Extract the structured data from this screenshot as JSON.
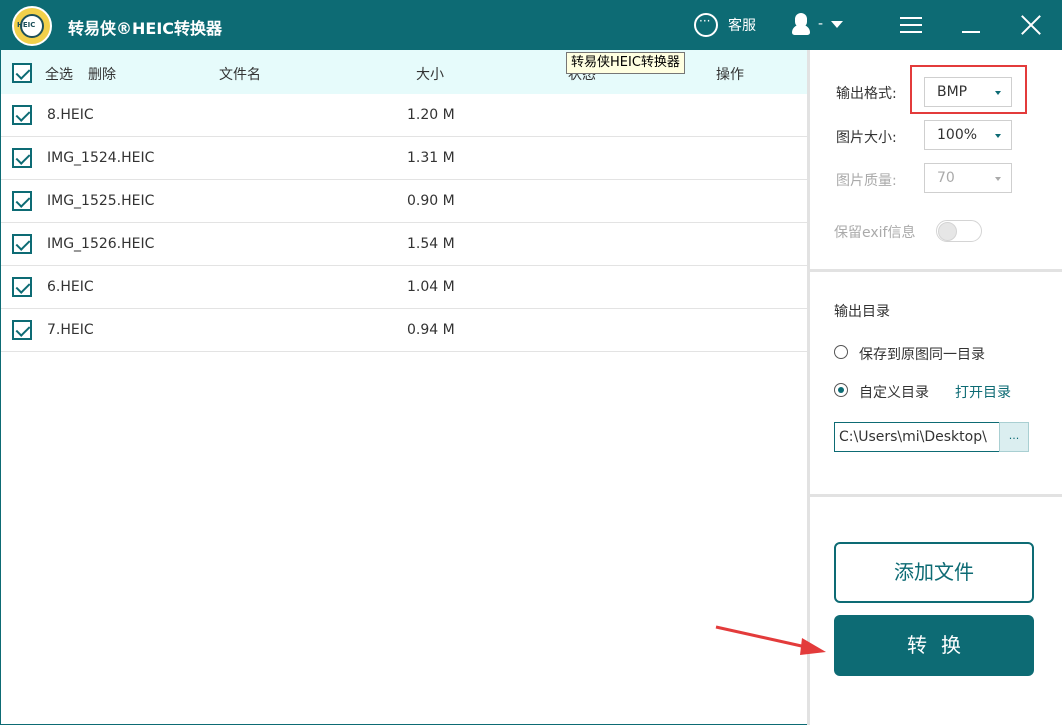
{
  "app": {
    "title": "转易侠®HEIC转换器",
    "logo_text": "HEIC",
    "service_label": "客服",
    "user_name": "-",
    "tooltip": "转易侠HEIC转换器"
  },
  "table": {
    "select_all": "全选",
    "delete": "删除",
    "col_name": "文件名",
    "col_size": "大小",
    "col_status": "状态",
    "col_action": "操作",
    "rows": [
      {
        "name": "8.HEIC",
        "size": "1.20 M",
        "checked": true
      },
      {
        "name": "IMG_1524.HEIC",
        "size": "1.31 M",
        "checked": true
      },
      {
        "name": "IMG_1525.HEIC",
        "size": "0.90 M",
        "checked": true
      },
      {
        "name": "IMG_1526.HEIC",
        "size": "1.54 M",
        "checked": true
      },
      {
        "name": "6.HEIC",
        "size": "1.04 M",
        "checked": true
      },
      {
        "name": "7.HEIC",
        "size": "0.94 M",
        "checked": true
      }
    ]
  },
  "settings": {
    "format_label": "输出格式:",
    "format_value": "BMP",
    "size_label": "图片大小:",
    "size_value": "100%",
    "quality_label": "图片质量:",
    "quality_value": "70",
    "exif_label": "保留exif信息",
    "exif_enabled": false
  },
  "output": {
    "title": "输出目录",
    "option_same": "保存到原图同一目录",
    "option_custom": "自定义目录",
    "open_dir": "打开目录",
    "path": "C:\\Users\\mi\\Desktop\\",
    "browse": "..."
  },
  "actions": {
    "add_files": "添加文件",
    "convert": "转换"
  },
  "colors": {
    "primary": "#0d6b74",
    "header_bg": "#e6fbfb",
    "highlight": "#e33b3b"
  }
}
